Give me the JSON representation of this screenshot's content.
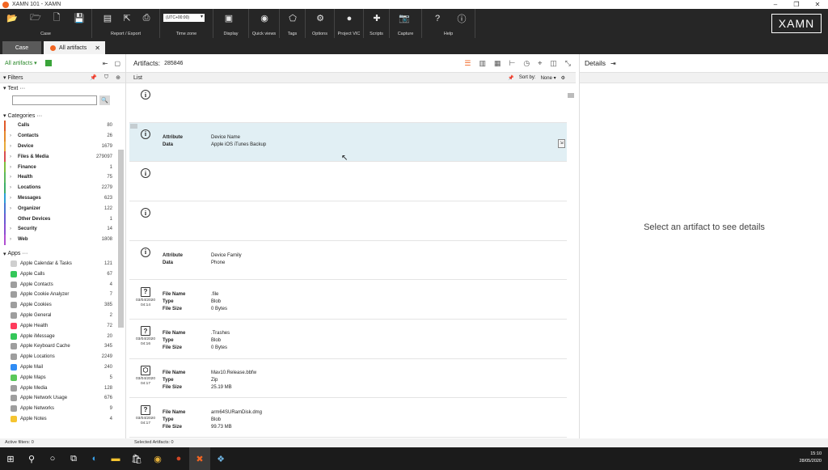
{
  "window": {
    "title": "XAMN 101 - XAMN",
    "minimize": "–",
    "maximize": "❐",
    "close": "✕"
  },
  "ribbon": {
    "groups": [
      {
        "label": "Case"
      },
      {
        "label": "Report / Export"
      },
      {
        "label": "Time zone",
        "value": "(UTC+00:00)"
      },
      {
        "label": "Display"
      },
      {
        "label": "Quick views"
      },
      {
        "label": "Tags"
      },
      {
        "label": "Options"
      },
      {
        "label": "Project VIC"
      },
      {
        "label": "Scripts"
      },
      {
        "label": "Capture"
      },
      {
        "label": "Help"
      }
    ],
    "brand": "XAMN"
  },
  "tabs": {
    "case": "Case",
    "all_artifacts": "All artifacts"
  },
  "left": {
    "view_selector": "All artifacts",
    "filters_title": "Filters",
    "text_section": "Text",
    "categories_title": "Categories",
    "categories": [
      {
        "name": "Calls",
        "count": "80",
        "color": "#e05a2a",
        "expand": ""
      },
      {
        "name": "Contacts",
        "count": "26",
        "color": "#e58a2c",
        "expand": "›"
      },
      {
        "name": "Device",
        "count": "1679",
        "color": "#e8a93a",
        "expand": "›"
      },
      {
        "name": "Files & Media",
        "count": "279097",
        "color": "#d94f4f",
        "expand": "›"
      },
      {
        "name": "Finance",
        "count": "1",
        "color": "#7fbf3f",
        "expand": "›"
      },
      {
        "name": "Health",
        "count": "75",
        "color": "#5cb85c",
        "expand": "›"
      },
      {
        "name": "Locations",
        "count": "2279",
        "color": "#3fae6a",
        "expand": "›"
      },
      {
        "name": "Messages",
        "count": "623",
        "color": "#2f9fd6",
        "expand": "›"
      },
      {
        "name": "Organizer",
        "count": "122",
        "color": "#4a76d1",
        "expand": "›"
      },
      {
        "name": "Other Devices",
        "count": "1",
        "color": "#6b5bd1",
        "expand": ""
      },
      {
        "name": "Security",
        "count": "14",
        "color": "#8a4fd1",
        "expand": "›"
      },
      {
        "name": "Web",
        "count": "1808",
        "color": "#b04fd1",
        "expand": "›"
      }
    ],
    "apps_title": "Apps",
    "apps": [
      {
        "name": "Apple Calendar & Tasks",
        "count": "121",
        "color": "#cfcfcf"
      },
      {
        "name": "Apple Calls",
        "count": "67",
        "color": "#34c759"
      },
      {
        "name": "Apple Contacts",
        "count": "4",
        "color": "#9e9e9e"
      },
      {
        "name": "Apple Cookie Analyzer",
        "count": "7",
        "color": "#9e9e9e"
      },
      {
        "name": "Apple Cookies",
        "count": "385",
        "color": "#9e9e9e"
      },
      {
        "name": "Apple General",
        "count": "2",
        "color": "#9e9e9e"
      },
      {
        "name": "Apple Health",
        "count": "72",
        "color": "#ff3b5c"
      },
      {
        "name": "Apple iMessage",
        "count": "20",
        "color": "#34c759"
      },
      {
        "name": "Apple Keyboard Cache",
        "count": "345",
        "color": "#9e9e9e"
      },
      {
        "name": "Apple Locations",
        "count": "2249",
        "color": "#9e9e9e"
      },
      {
        "name": "Apple Mail",
        "count": "240",
        "color": "#2f8cf5"
      },
      {
        "name": "Apple Maps",
        "count": "5",
        "color": "#5ac85a"
      },
      {
        "name": "Apple Media",
        "count": "128",
        "color": "#9e9e9e"
      },
      {
        "name": "Apple Network Usage",
        "count": "676",
        "color": "#9e9e9e"
      },
      {
        "name": "Apple Networks",
        "count": "9",
        "color": "#9e9e9e"
      },
      {
        "name": "Apple Notes",
        "count": "4",
        "color": "#f5c430"
      }
    ],
    "status": "Active filters: 0"
  },
  "center": {
    "artifacts_label": "Artifacts:",
    "artifacts_count": "285846",
    "list_label": "List",
    "sort_label": "Sort by:",
    "sort_value": "None",
    "status": "Selected Artifacts: 0",
    "rows": [
      {
        "icon": "i",
        "date": "",
        "fields": [],
        "selected": false
      },
      {
        "icon": "i",
        "date": "",
        "fields": [
          {
            "k": "Attribute",
            "v": "Device Name"
          },
          {
            "k": "Data",
            "v": "Apple iOS iTunes Backup"
          }
        ],
        "selected": true
      },
      {
        "icon": "i",
        "date": "",
        "fields": [],
        "selected": false
      },
      {
        "icon": "i",
        "date": "",
        "fields": [],
        "selected": false
      },
      {
        "icon": "i",
        "date": "",
        "fields": [
          {
            "k": "Attribute",
            "v": "Device Family"
          },
          {
            "k": "Data",
            "v": "Phone"
          }
        ],
        "selected": false
      },
      {
        "icon": "?",
        "date": "03/04/2020\n04:14",
        "fields": [
          {
            "k": "File Name",
            "v": ".file"
          },
          {
            "k": "Type",
            "v": "Blob"
          },
          {
            "k": "File Size",
            "v": "0 Bytes"
          }
        ],
        "selected": false
      },
      {
        "icon": "?",
        "date": "03/04/2020\n04:16",
        "fields": [
          {
            "k": "File Name",
            "v": ".Trashes"
          },
          {
            "k": "Type",
            "v": "Blob"
          },
          {
            "k": "File Size",
            "v": "0 Bytes"
          }
        ],
        "selected": false
      },
      {
        "icon": "⬡",
        "date": "03/04/2020\n04:17",
        "fields": [
          {
            "k": "File Name",
            "v": "Mav10.Release.bbfw"
          },
          {
            "k": "Type",
            "v": "Zip"
          },
          {
            "k": "File Size",
            "v": "25.19 MB"
          }
        ],
        "selected": false
      },
      {
        "icon": "?",
        "date": "03/04/2020\n04:17",
        "fields": [
          {
            "k": "File Name",
            "v": "arm64SURamDisk.dmg"
          },
          {
            "k": "Type",
            "v": "Blob"
          },
          {
            "k": "File Size",
            "v": "99.73 MB"
          }
        ],
        "selected": false
      }
    ]
  },
  "right": {
    "title": "Details",
    "placeholder": "Select an artifact to see details"
  },
  "taskbar": {
    "time": "15:10",
    "date": "28/05/2020"
  }
}
